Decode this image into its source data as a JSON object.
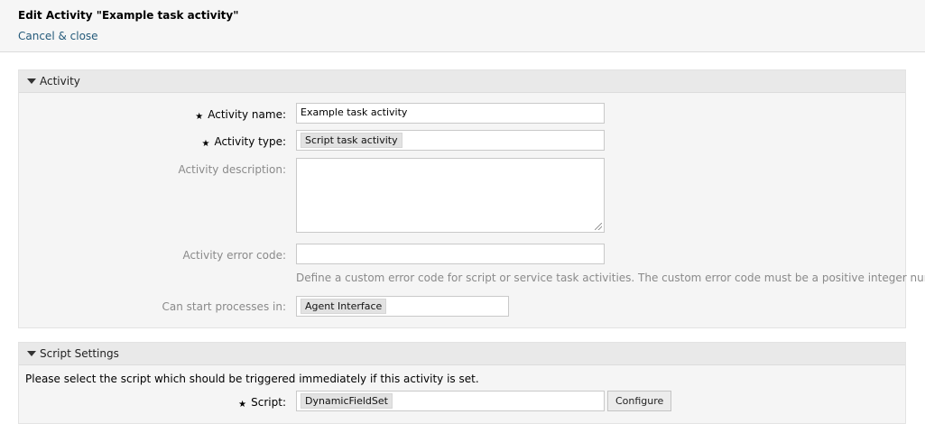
{
  "header": {
    "title": "Edit Activity \"Example task activity\"",
    "cancel_label": "Cancel & close"
  },
  "activity_section": {
    "title": "Activity",
    "fields": {
      "name": {
        "label": "Activity name:",
        "value": "Example task activity"
      },
      "type": {
        "label": "Activity type:",
        "value": "Script task activity"
      },
      "description": {
        "label": "Activity description:",
        "value": ""
      },
      "error_code": {
        "label": "Activity error code:",
        "value": "",
        "help": "Define a custom error code for script or service task activities. The custom error code must be a positive integer number."
      },
      "start_in": {
        "label": "Can start processes in:",
        "value": "Agent Interface"
      }
    }
  },
  "script_section": {
    "title": "Script Settings",
    "intro": "Please select the script which should be triggered immediately if this activity is set.",
    "script": {
      "label": "Script:",
      "value": "DynamicFieldSet"
    },
    "configure_label": "Configure"
  },
  "required_marker": "★",
  "icons": {
    "collapse": "triangle-down-icon",
    "resize": "resize-grip-icon"
  },
  "colors": {
    "link": "#245a7a",
    "header_bg": "#f6f6f6",
    "widget_bg": "#f5f5f5",
    "widget_header_bg": "#e9e9e9"
  }
}
